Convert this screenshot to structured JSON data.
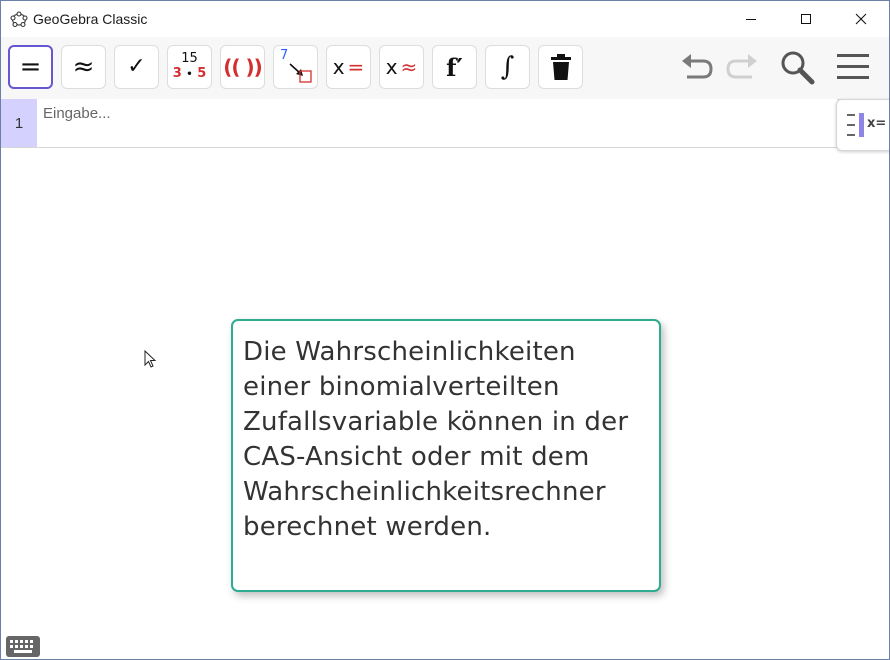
{
  "window": {
    "title": "GeoGebra Classic",
    "controls": [
      "minimize",
      "maximize",
      "close"
    ]
  },
  "toolbar": {
    "buttons": [
      {
        "name": "evaluate",
        "label": "=",
        "active": true
      },
      {
        "name": "numeric",
        "label": "≈"
      },
      {
        "name": "keep-input",
        "label": "✓"
      },
      {
        "name": "factor",
        "top": "15",
        "bottom_left": "3",
        "dot": "•",
        "bottom_right": "5"
      },
      {
        "name": "expand",
        "label": "(( ))"
      },
      {
        "name": "substitute",
        "label": "7"
      },
      {
        "name": "solve",
        "x": "x",
        "eq": "="
      },
      {
        "name": "solve-numerically",
        "x": "x",
        "eq": "≈"
      },
      {
        "name": "derivative",
        "label": "f′"
      },
      {
        "name": "integral",
        "label": "∫"
      },
      {
        "name": "delete",
        "icon": "trash-icon"
      }
    ],
    "right": [
      "undo-icon",
      "redo-icon",
      "search-icon",
      "menu-icon"
    ]
  },
  "cas": {
    "row_number": "1",
    "input_placeholder": "Eingabe...",
    "side_toggle_label": "x="
  },
  "tooltip": {
    "text": "Die Wahrscheinlichkeiten einer binomialverteilten Zufallsvariable können in der CAS-Ansicht oder mit dem Wahrscheinlichkeitsrechner berechnet werden."
  },
  "colors": {
    "accent": "#6557d2",
    "red": "#d32f2f",
    "tooltip_border": "#2eab91",
    "row_highlight": "#d4d1ff"
  }
}
